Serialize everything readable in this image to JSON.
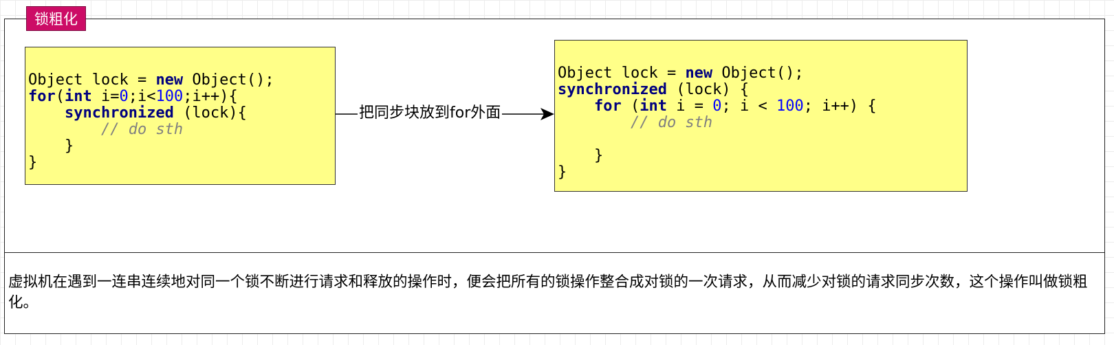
{
  "title": "锁粗化",
  "left_code": [
    [
      {
        "t": "Object lock = "
      },
      {
        "t": "new",
        "c": "kw"
      },
      {
        "t": " Object();"
      }
    ],
    [
      {
        "t": "for",
        "c": "kw"
      },
      {
        "t": "("
      },
      {
        "t": "int",
        "c": "kw"
      },
      {
        "t": " i="
      },
      {
        "t": "0",
        "c": "num"
      },
      {
        "t": ";i<"
      },
      {
        "t": "100",
        "c": "num"
      },
      {
        "t": ";i++){"
      }
    ],
    [
      {
        "t": "    "
      },
      {
        "t": "synchronized",
        "c": "kw"
      },
      {
        "t": " (lock){"
      }
    ],
    [
      {
        "t": "        "
      },
      {
        "t": "// do sth",
        "c": "cm"
      }
    ],
    [
      {
        "t": "    }"
      }
    ],
    [
      {
        "t": "}"
      }
    ]
  ],
  "right_code": [
    [
      {
        "t": "Object lock = "
      },
      {
        "t": "new",
        "c": "kw"
      },
      {
        "t": " Object();"
      }
    ],
    [
      {
        "t": "synchronized",
        "c": "kw"
      },
      {
        "t": " (lock) {"
      }
    ],
    [
      {
        "t": "    "
      },
      {
        "t": "for",
        "c": "kw"
      },
      {
        "t": " ("
      },
      {
        "t": "int",
        "c": "kw"
      },
      {
        "t": " i = "
      },
      {
        "t": "0",
        "c": "num"
      },
      {
        "t": "; i < "
      },
      {
        "t": "100",
        "c": "num"
      },
      {
        "t": "; i++) {"
      }
    ],
    [
      {
        "t": "        "
      },
      {
        "t": "// do sth",
        "c": "cm"
      }
    ],
    [
      {
        "t": ""
      }
    ],
    [
      {
        "t": "    }"
      }
    ],
    [
      {
        "t": "}"
      }
    ]
  ],
  "arrow_label": "把同步块放到for外面",
  "description": "虚拟机在遇到一连串连续地对同一个锁不断进行请求和释放的操作时，便会把所有的锁操作整合成对锁的一次请求，从而减少对锁的请求同步次数，这个操作叫做锁粗化。",
  "colors": {
    "title_tag": "#cc0c66",
    "code_box": "#ffff88",
    "keyword": "#00007f",
    "number": "#0000ff",
    "comment": "#808080"
  }
}
